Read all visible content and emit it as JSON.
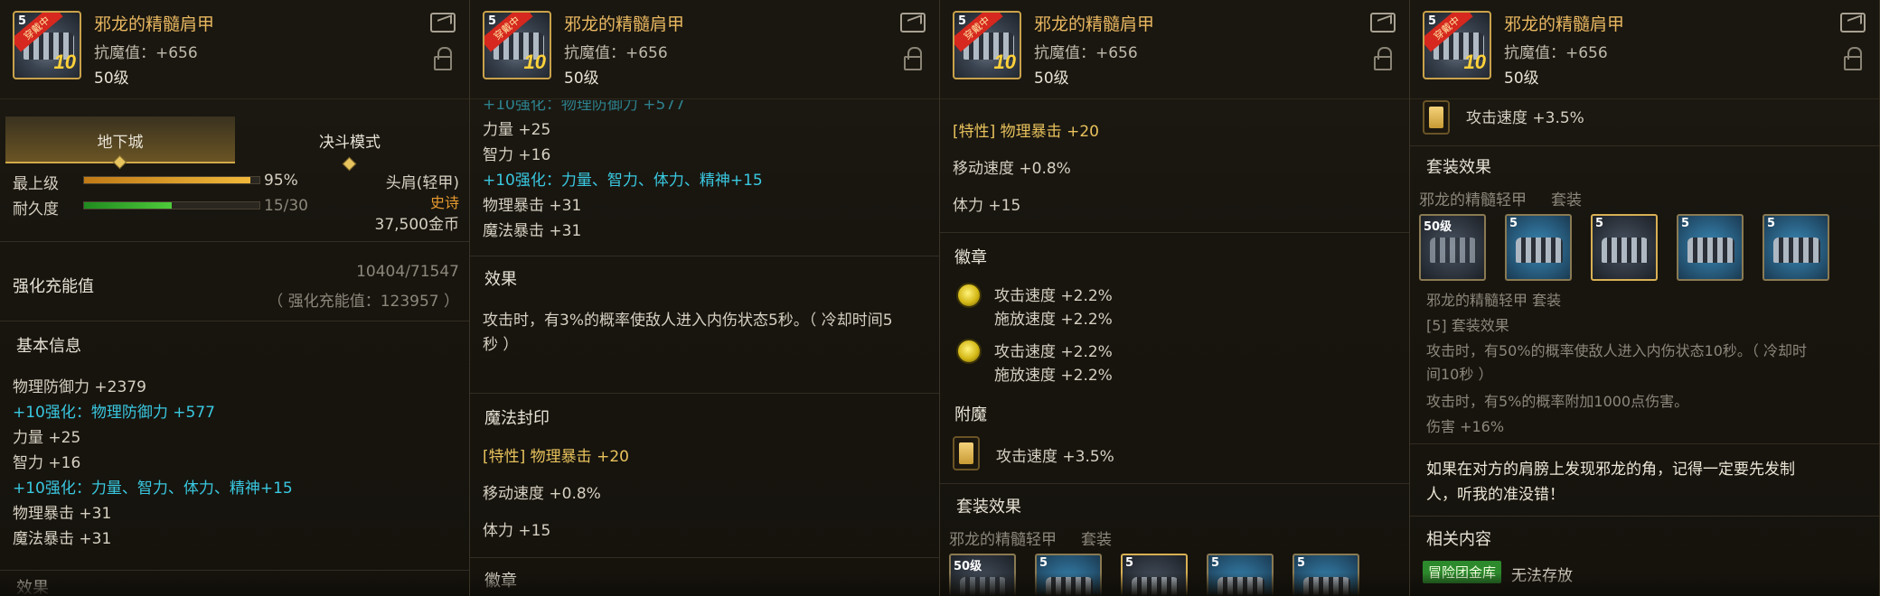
{
  "item": {
    "title": "邪龙的精髓肩甲",
    "resist": "抗魔值：+656",
    "level": "50级",
    "icon_level": "10",
    "icon_badge": "穿戴中",
    "icon_num": "5"
  },
  "tabs": [
    "地下城",
    "决斗模式"
  ],
  "stats": {
    "max_level_label": "最上级",
    "max_level_value": "95%",
    "max_level_pct": 0.95,
    "durability_label": "耐久度",
    "durability_value": "15/30",
    "durability_pct": 0.5,
    "slot": "头肩(轻甲)",
    "rarity": "史诗",
    "price": "37,500金币"
  },
  "charge": {
    "label": "强化充能值",
    "value": "10404/71547",
    "sub": "（ 强化充能值：123957 ）"
  },
  "basic": {
    "label": "基本信息",
    "lines": [
      {
        "text": "物理防御力 +2379",
        "color": "normal"
      },
      {
        "text": "+10强化：物理防御力 +577",
        "color": "cyan"
      },
      {
        "text": "力量 +25",
        "color": "normal"
      },
      {
        "text": "智力 +16",
        "color": "normal"
      },
      {
        "text": "+10强化：力量、智力、体力、精神+15",
        "color": "cyan"
      },
      {
        "text": "物理暴击 +31",
        "color": "normal"
      },
      {
        "text": "魔法暴击 +31",
        "color": "normal"
      }
    ],
    "partial_next": "效果",
    "partial_prev": "+10强化：物理防御力 +577"
  },
  "effect": {
    "label": "效果",
    "text1": "攻击时，有3%的概率使敌人进入内伤状态5秒。（ 冷却时间5",
    "text2": "秒 ）"
  },
  "seal": {
    "label": "魔法封印",
    "trait": "[特性] 物理暴击 +20",
    "line2": "移动速度 +0.8%",
    "line3": "体力 +15"
  },
  "emblem": {
    "label": "徽章",
    "gem1_a": "攻击速度 +2.2%",
    "gem1_b": "施放速度 +2.2%",
    "gem2_a": "攻击速度 +2.2%",
    "gem2_b": "施放速度 +2.2%"
  },
  "enchant": {
    "label": "附魔",
    "text": "攻击速度 +3.5%"
  },
  "set": {
    "label": "套装效果",
    "name": "邪龙的精髓轻甲",
    "suffix": "套装",
    "piece1_label": "50级",
    "piece_num": "5",
    "name_line": "邪龙的精髓轻甲   套装",
    "bonus_label": "[5] 套装效果",
    "bonus1": "攻击时，有50%的概率使敌人进入内伤状态10秒。（ 冷却时",
    "bonus2": "间10秒 ）",
    "bonus3": "攻击时，有5%的概率附加1000点伤害。",
    "bonus4": "伤害 +16%"
  },
  "flavor": {
    "line1": "如果在对方的肩膀上发现邪龙的角，记得一定要先发制",
    "line2": "人，听我的准没错！"
  },
  "related": {
    "label": "相关内容",
    "badge": "冒险团金库",
    "text": "无法存放"
  }
}
